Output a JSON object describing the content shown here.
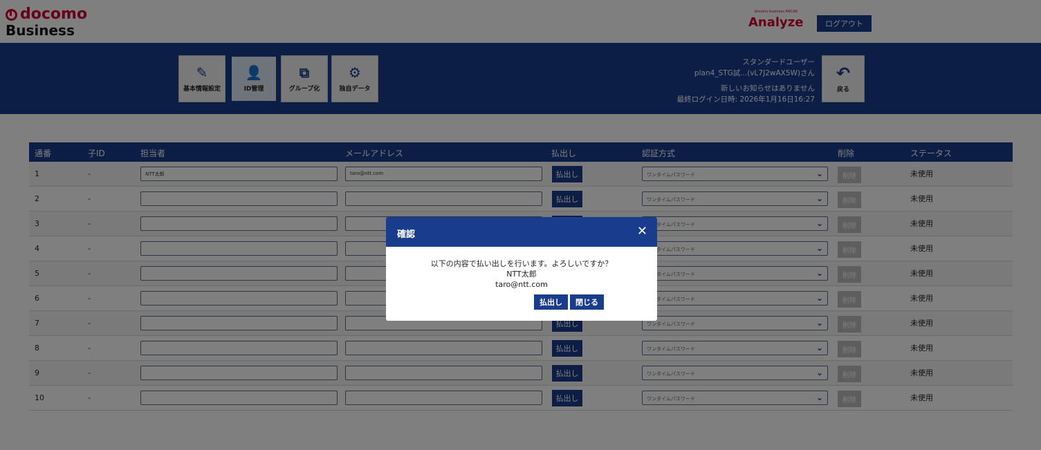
{
  "header": {
    "brand_line1": "docomo",
    "brand_line2": "Business",
    "product_small": "docomo business ANCAR",
    "product_name": "Analyze",
    "logout_label": "ログアウト"
  },
  "nav": {
    "items": [
      {
        "label": "基本情報設定",
        "icon": "edit-icon"
      },
      {
        "label": "ID管理",
        "icon": "id-card-icon"
      },
      {
        "label": "グループ化",
        "icon": "group-icon"
      },
      {
        "label": "独自データ",
        "icon": "data-icon"
      }
    ],
    "user_type": "スタンダードユーザー",
    "user_name": "plan4_STG試...(vL7J2wAX5W)さん",
    "notice": "新しいお知らせはありません",
    "last_login": "最終ログイン日時: 2026年1月16日16:27",
    "back_label": "戻る"
  },
  "table": {
    "headers": [
      "通番",
      "子ID",
      "担当者",
      "メールアドレス",
      "払出し",
      "認証方式",
      "削除",
      "ステータス"
    ],
    "payout_label": "払出し",
    "auth_method": "ワンタイムパスワード",
    "delete_label": "削除",
    "rows": [
      {
        "no": "1",
        "child_id": "-",
        "name": "NTT太郎",
        "email": "taro@ntt.com",
        "status": "未使用"
      },
      {
        "no": "2",
        "child_id": "-",
        "name": "",
        "email": "",
        "status": "未使用"
      },
      {
        "no": "3",
        "child_id": "-",
        "name": "",
        "email": "",
        "status": "未使用"
      },
      {
        "no": "4",
        "child_id": "-",
        "name": "",
        "email": "",
        "status": "未使用"
      },
      {
        "no": "5",
        "child_id": "-",
        "name": "",
        "email": "",
        "status": "未使用"
      },
      {
        "no": "6",
        "child_id": "-",
        "name": "",
        "email": "",
        "status": "未使用"
      },
      {
        "no": "7",
        "child_id": "-",
        "name": "",
        "email": "",
        "status": "未使用"
      },
      {
        "no": "8",
        "child_id": "-",
        "name": "",
        "email": "",
        "status": "未使用"
      },
      {
        "no": "9",
        "child_id": "-",
        "name": "",
        "email": "",
        "status": "未使用"
      },
      {
        "no": "10",
        "child_id": "-",
        "name": "",
        "email": "",
        "status": "未使用"
      }
    ]
  },
  "modal": {
    "title": "確認",
    "message": "以下の内容で払い出しを行います。よろしいですか？",
    "name": "NTT太郎",
    "email": "taro@ntt.com",
    "confirm_label": "払出し",
    "close_label": "閉じる"
  }
}
